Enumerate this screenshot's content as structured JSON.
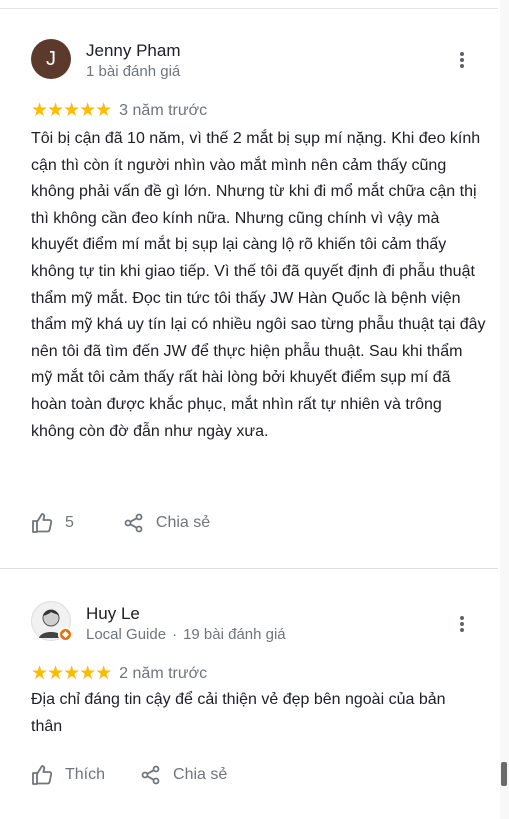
{
  "reviews": [
    {
      "author": "Jenny Pham",
      "avatar_letter": "J",
      "avatar_color": "#5b3a2c",
      "meta": "1 bài đánh giá",
      "stars": "★★★★★",
      "rating": 5,
      "date": "3 năm trước",
      "text": "Tôi bị cận đã 10 năm, vì thế 2 mắt bị sụp mí nặng. Khi đeo kính cận thì còn ít người nhìn vào mắt mình nên cảm thấy cũng không phải vấn đề gì lớn. Nhưng từ khi đi mổ mắt chữa cận thị thì không cần đeo kính nữa. Nhưng cũng chính vì vậy mà khuyết điểm mí mắt bị sụp lại càng lộ rõ khiến tôi cảm thấy không tự tin khi giao tiếp. Vì thế tôi đã quyết định đi phẫu thuật thẩm mỹ mắt. Đọc tin tức tôi thấy JW Hàn Quốc là bệnh viện thẩm mỹ khá uy tín lại có nhiều ngôi sao từng phẫu thuật tại đây nên tôi đã tìm đến JW để thực hiện phẫu thuật. Sau khi thẩm mỹ mắt tôi cảm thấy rất hài lòng bởi khuyết điểm sụp mí đã hoàn toàn được khắc phục, mắt nhìn rất tự nhiên và trông không còn đờ đẫn như ngày xưa.",
      "like_label": "5",
      "share_label": "Chia sẻ"
    },
    {
      "author": "Huy Le",
      "meta_guide": "Local Guide",
      "meta_separator": "·",
      "meta_reviews": "19 bài đánh giá",
      "stars": "★★★★★",
      "rating": 5,
      "date": "2 năm trước",
      "text": "Địa chỉ đáng tin cậy để cải thiện vẻ đẹp bên ngoài của bản thân",
      "like_label": "Thích",
      "share_label": "Chia sẻ"
    }
  ],
  "colors": {
    "star": "#fbbc04",
    "secondary_text": "#70757a",
    "local_guide_badge": "#e8710a"
  }
}
